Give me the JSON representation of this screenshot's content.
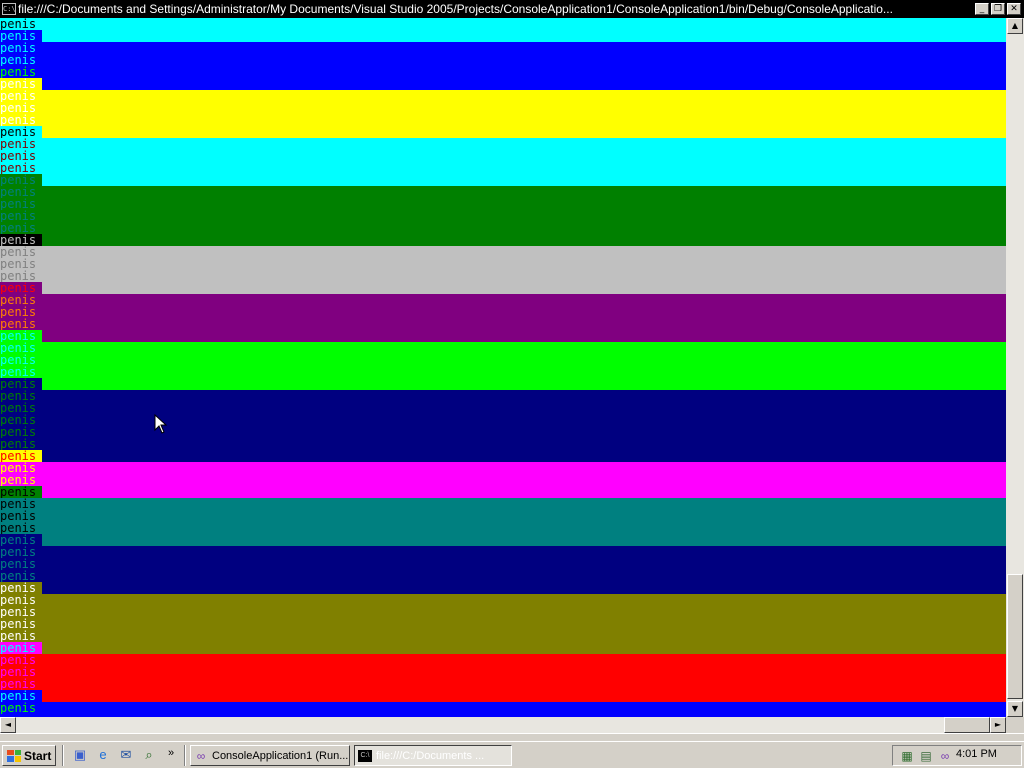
{
  "window": {
    "title": "file:///C:/Documents and Settings/Administrator/My Documents/Visual Studio 2005/Projects/ConsoleApplication1/ConsoleApplication1/bin/Debug/ConsoleApplicatio...",
    "sys_icon_label": "C:\\",
    "minimize_label": "_",
    "restore_label": "❐",
    "close_label": "✕"
  },
  "console": {
    "text": "penis",
    "lines": [
      {
        "fg": "#000000",
        "bg": "#00ffff"
      },
      {
        "fg": "#00ffff",
        "bg": "#0000ff"
      },
      {
        "fg": "#00ffff",
        "bg": "#0000ff"
      },
      {
        "fg": "#00ffff",
        "bg": "#0000ff"
      },
      {
        "fg": "#00ff00",
        "bg": "#0000ff"
      },
      {
        "fg": "#ffffff",
        "bg": "#ffff00"
      },
      {
        "fg": "#ffffff",
        "bg": "#ffff00"
      },
      {
        "fg": "#ffffff",
        "bg": "#ffff00"
      },
      {
        "fg": "#ffffff",
        "bg": "#ffff00"
      },
      {
        "fg": "#000000",
        "bg": "#00ffff"
      },
      {
        "fg": "#800000",
        "bg": "#00ffff"
      },
      {
        "fg": "#800000",
        "bg": "#00ffff"
      },
      {
        "fg": "#800000",
        "bg": "#00ffff"
      },
      {
        "fg": "#008080",
        "bg": "#008000"
      },
      {
        "fg": "#008080",
        "bg": "#008000"
      },
      {
        "fg": "#008080",
        "bg": "#008000"
      },
      {
        "fg": "#008080",
        "bg": "#008000"
      },
      {
        "fg": "#008080",
        "bg": "#008000"
      },
      {
        "fg": "#c0c0c0",
        "bg": "#000000"
      },
      {
        "fg": "#808080",
        "bg": "#c0c0c0"
      },
      {
        "fg": "#808080",
        "bg": "#c0c0c0"
      },
      {
        "fg": "#808080",
        "bg": "#c0c0c0"
      },
      {
        "fg": "#ff0000",
        "bg": "#800080"
      },
      {
        "fg": "#ff8000",
        "bg": "#800080"
      },
      {
        "fg": "#ff8000",
        "bg": "#800080"
      },
      {
        "fg": "#ff8000",
        "bg": "#800080"
      },
      {
        "fg": "#00ffff",
        "bg": "#00ff00"
      },
      {
        "fg": "#00ffff",
        "bg": "#00ff00"
      },
      {
        "fg": "#00ffff",
        "bg": "#00ff00"
      },
      {
        "fg": "#00ffff",
        "bg": "#00ff00"
      },
      {
        "fg": "#008000",
        "bg": "#000080"
      },
      {
        "fg": "#008000",
        "bg": "#000080"
      },
      {
        "fg": "#008000",
        "bg": "#000080"
      },
      {
        "fg": "#008000",
        "bg": "#000080"
      },
      {
        "fg": "#008000",
        "bg": "#000080"
      },
      {
        "fg": "#008000",
        "bg": "#000080"
      },
      {
        "fg": "#ff0000",
        "bg": "#ffff00"
      },
      {
        "fg": "#ffff00",
        "bg": "#ff00ff"
      },
      {
        "fg": "#ffff00",
        "bg": "#ff00ff"
      },
      {
        "fg": "#000000",
        "bg": "#008000"
      },
      {
        "fg": "#000000",
        "bg": "#008080"
      },
      {
        "fg": "#000000",
        "bg": "#008080"
      },
      {
        "fg": "#000000",
        "bg": "#008080"
      },
      {
        "fg": "#008080",
        "bg": "#000080"
      },
      {
        "fg": "#008080",
        "bg": "#000080"
      },
      {
        "fg": "#008080",
        "bg": "#000080"
      },
      {
        "fg": "#008080",
        "bg": "#000080"
      },
      {
        "fg": "#ffffff",
        "bg": "#808000"
      },
      {
        "fg": "#ffffff",
        "bg": "#808000"
      },
      {
        "fg": "#ffffff",
        "bg": "#808000"
      },
      {
        "fg": "#ffffff",
        "bg": "#808000"
      },
      {
        "fg": "#ffffff",
        "bg": "#808000"
      },
      {
        "fg": "#00ffff",
        "bg": "#ff00ff"
      },
      {
        "fg": "#ff00ff",
        "bg": "#ff0000"
      },
      {
        "fg": "#ff00ff",
        "bg": "#ff0000"
      },
      {
        "fg": "#ff00ff",
        "bg": "#ff0000"
      },
      {
        "fg": "#00ffff",
        "bg": "#0000ff"
      },
      {
        "fg": "#00ff00",
        "bg": "#0000ff"
      }
    ],
    "bands": [
      {
        "color": "#00ffff",
        "from": 0,
        "to": 2
      },
      {
        "color": "#0000ff",
        "from": 2,
        "to": 6
      },
      {
        "color": "#ffff00",
        "from": 6,
        "to": 10
      },
      {
        "color": "#00ffff",
        "from": 10,
        "to": 14
      },
      {
        "color": "#008000",
        "from": 14,
        "to": 19
      },
      {
        "color": "#c0c0c0",
        "from": 19,
        "to": 23
      },
      {
        "color": "#800080",
        "from": 23,
        "to": 27
      },
      {
        "color": "#00ff00",
        "from": 27,
        "to": 31
      },
      {
        "color": "#000080",
        "from": 31,
        "to": 37
      },
      {
        "color": "#ff00ff",
        "from": 37,
        "to": 40
      },
      {
        "color": "#008080",
        "from": 40,
        "to": 44
      },
      {
        "color": "#000080",
        "from": 44,
        "to": 48
      },
      {
        "color": "#808000",
        "from": 48,
        "to": 53
      },
      {
        "color": "#ff0000",
        "from": 53,
        "to": 57
      },
      {
        "color": "#0000ff",
        "from": 57,
        "to": 60
      }
    ]
  },
  "scrollbars": {
    "up_label": "▲",
    "down_label": "▼",
    "left_label": "◄",
    "right_label": "►"
  },
  "taskbar": {
    "start_label": "Start",
    "flag_colors": [
      "#e74c1c",
      "#3bb03b",
      "#2f6fe0",
      "#f5c400"
    ],
    "quick_launch": [
      "show-desktop-icon",
      "internet-explorer-icon",
      "outlook-icon",
      "search-icon"
    ],
    "overflow_label": "»",
    "tasks": [
      {
        "label": "ConsoleApplication1 (Run...",
        "icon": "visual-studio-icon",
        "active": false
      },
      {
        "label": "file:///C:/Documents ...",
        "icon": "console-icon",
        "active": true
      }
    ],
    "tray_icons": [
      "network-icon",
      "printer-icon",
      "visual-studio-icon"
    ],
    "clock": "4:01 PM"
  }
}
